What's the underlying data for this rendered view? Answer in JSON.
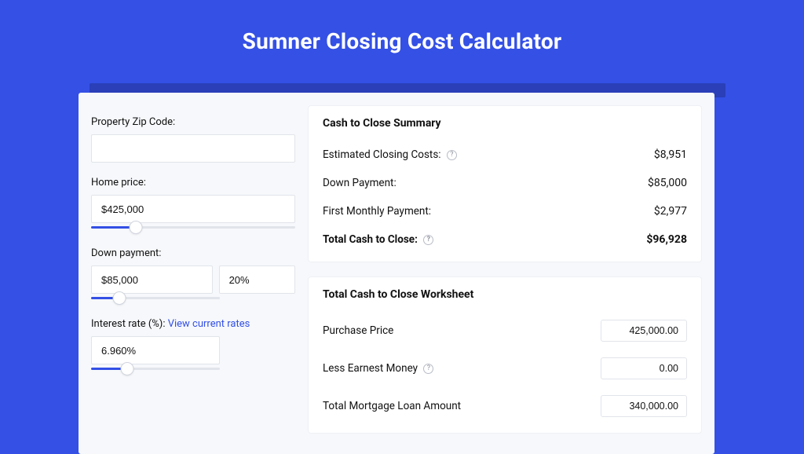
{
  "title": "Sumner Closing Cost Calculator",
  "form": {
    "zip_label": "Property Zip Code:",
    "zip_value": "",
    "home_price_label": "Home price:",
    "home_price_value": "$425,000",
    "home_price_slider_pct": 22,
    "down_payment_label": "Down payment:",
    "down_payment_value": "$85,000",
    "down_payment_pct_value": "20%",
    "down_payment_slider_pct": 22,
    "interest_label_prefix": "Interest rate (%): ",
    "interest_link": "View current rates",
    "interest_value": "6.960%",
    "interest_slider_pct": 28
  },
  "summary": {
    "heading": "Cash to Close Summary",
    "rows": [
      {
        "label": "Estimated Closing Costs:",
        "help": true,
        "value": "$8,951",
        "bold": false
      },
      {
        "label": "Down Payment:",
        "help": false,
        "value": "$85,000",
        "bold": false
      },
      {
        "label": "First Monthly Payment:",
        "help": false,
        "value": "$2,977",
        "bold": false
      },
      {
        "label": "Total Cash to Close:",
        "help": true,
        "value": "$96,928",
        "bold": true
      }
    ]
  },
  "worksheet": {
    "heading": "Total Cash to Close Worksheet",
    "rows": [
      {
        "label": "Purchase Price",
        "help": false,
        "value": "425,000.00"
      },
      {
        "label": "Less Earnest Money",
        "help": true,
        "value": "0.00"
      },
      {
        "label": "Total Mortgage Loan Amount",
        "help": false,
        "value": "340,000.00"
      }
    ]
  }
}
